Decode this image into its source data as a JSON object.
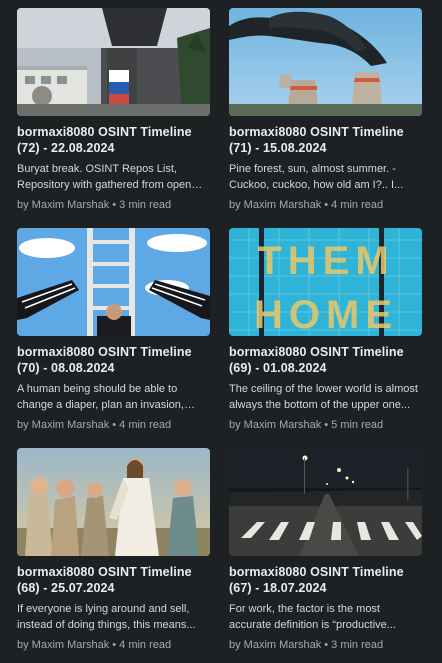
{
  "posts": [
    {
      "title_line1": "bormaxi8080 OSINT Timeline",
      "title_line2": "(72) - 22.08.2024",
      "excerpt": "Buryat break. OSINT Repos List, Repository with gathered from open sources...",
      "author": "by Maxim Marshak",
      "read_time": "3 min read"
    },
    {
      "title_line1": "bormaxi8080 OSINT Timeline",
      "title_line2": "(71) - 15.08.2024",
      "excerpt": "Pine forest, sun, almost summer. - Cuckoo, cuckoo, how old am I?.. I...",
      "author": "by Maxim Marshak",
      "read_time": "4 min read"
    },
    {
      "title_line1": "bormaxi8080 OSINT Timeline",
      "title_line2": "(70) - 08.08.2024",
      "excerpt": "A human being should be able to change a diaper, plan an invasion, and...",
      "author": "by Maxim Marshak",
      "read_time": "4 min read"
    },
    {
      "title_line1": "bormaxi8080 OSINT Timeline",
      "title_line2": "(69) - 01.08.2024",
      "excerpt": "The ceiling of the lower world is almost always the bottom of the upper one...",
      "author": "by Maxim Marshak",
      "read_time": "5 min read"
    },
    {
      "title_line1": "bormaxi8080 OSINT Timeline",
      "title_line2": "(68) - 25.07.2024",
      "excerpt": "If everyone is lying around and sell, instead of doing things, this means...",
      "author": "by Maxim Marshak",
      "read_time": "4 min read"
    },
    {
      "title_line1": "bormaxi8080 OSINT Timeline",
      "title_line2": "(67) - 18.07.2024",
      "excerpt": "For work, the factor is the most accurate definition is “productive...",
      "author": "by Maxim Marshak",
      "read_time": "3 min read"
    }
  ],
  "separator": "•",
  "thumb4_text": {
    "line1": "THEM",
    "line2": "HOME"
  },
  "colors": {
    "background": "#1e2124",
    "title": "#ebecee",
    "excerpt": "#d6d8db",
    "meta": "#a6a9ad"
  }
}
